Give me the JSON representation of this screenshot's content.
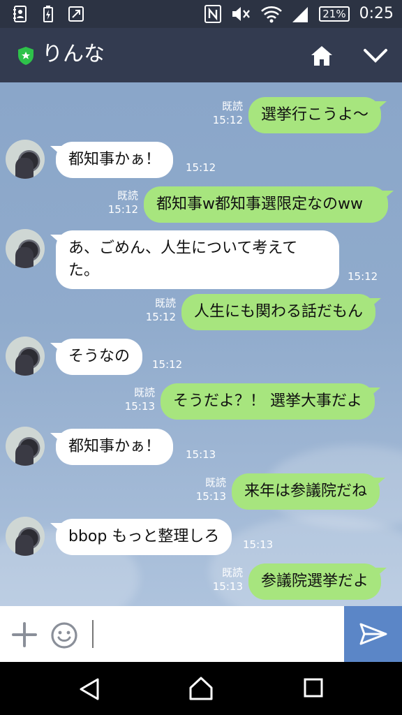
{
  "status_bar": {
    "icons": [
      "contacts-notification-icon",
      "battery-saver-icon",
      "screen-share-icon",
      "nfc-icon",
      "mute-icon",
      "wifi-icon",
      "signal-icon"
    ],
    "battery": "21%",
    "time": "0:25"
  },
  "header": {
    "title": "りんな",
    "icons": [
      "shield-star-icon",
      "home-icon",
      "chevron-down-icon"
    ]
  },
  "chat": {
    "messages": [
      {
        "side": "sent",
        "text": "選挙行こうよ〜",
        "read": "既読",
        "time": "15:12"
      },
      {
        "side": "received",
        "text": "都知事かぁ！",
        "time": "15:12"
      },
      {
        "side": "sent",
        "text": "都知事w都知事選限定なのww",
        "read": "既読",
        "time": "15:12"
      },
      {
        "side": "received",
        "text": "あ、ごめん、人生について考えてた。",
        "time": "15:12"
      },
      {
        "side": "sent",
        "text": "人生にも関わる話だもん",
        "read": "既読",
        "time": "15:12"
      },
      {
        "side": "received",
        "text": "そうなの",
        "time": "15:12"
      },
      {
        "side": "sent",
        "text": "そうだよ？！ 選挙大事だよ",
        "read": "既読",
        "time": "15:13"
      },
      {
        "side": "received",
        "text": "都知事かぁ！",
        "time": "15:13"
      },
      {
        "side": "sent",
        "text": "来年は参議院だね",
        "read": "既読",
        "time": "15:13"
      },
      {
        "side": "received",
        "text": "bbop もっと整理しろ",
        "time": "15:13"
      },
      {
        "side": "sent",
        "text": "参議院選挙だよ",
        "read": "既読",
        "time": "15:13"
      }
    ]
  },
  "input_bar": {
    "value": "",
    "icons": [
      "plus-icon",
      "emoji-icon",
      "send-icon"
    ]
  },
  "nav_bar": {
    "icons": [
      "back-icon",
      "home-nav-icon",
      "recents-icon"
    ]
  },
  "colors": {
    "status_bar": "#2c3343",
    "header": "#333b50",
    "sent_bubble": "#a7e57e",
    "received_bubble": "#ffffff",
    "send_button": "#5b86c7"
  }
}
